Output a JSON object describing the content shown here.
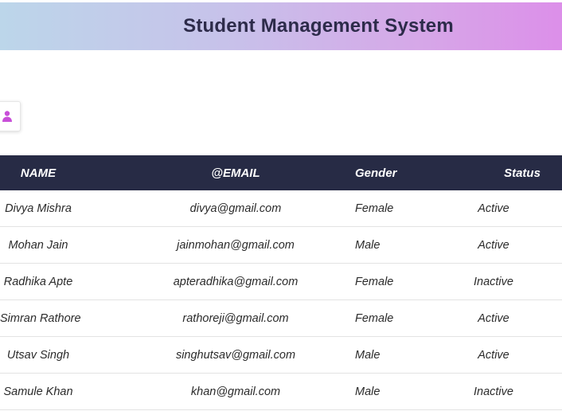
{
  "header": {
    "title": "Student Management System"
  },
  "toolbar": {
    "add_icon": "user-plus-icon",
    "accent_color": "#c84fd8"
  },
  "table": {
    "columns": [
      "NAME",
      "@EMAIL",
      "Gender",
      "Status"
    ],
    "rows": [
      {
        "name": "Divya Mishra",
        "email": "divya@gmail.com",
        "gender": "Female",
        "status": "Active"
      },
      {
        "name": "Mohan Jain",
        "email": "jainmohan@gmail.com",
        "gender": "Male",
        "status": "Active"
      },
      {
        "name": "Radhika Apte",
        "email": "apteradhika@gmail.com",
        "gender": "Female",
        "status": "Inactive"
      },
      {
        "name": "Simran Rathore",
        "email": "rathoreji@gmail.com",
        "gender": "Female",
        "status": "Active"
      },
      {
        "name": "Utsav Singh",
        "email": "singhutsav@gmail.com",
        "gender": "Male",
        "status": "Active"
      },
      {
        "name": "Samule Khan",
        "email": "khan@gmail.com",
        "gender": "Male",
        "status": "Inactive"
      }
    ]
  },
  "colors": {
    "header_gradient_start": "#bcd6ea",
    "header_gradient_end": "#dc8fe9",
    "table_header_bg": "#272b45"
  }
}
